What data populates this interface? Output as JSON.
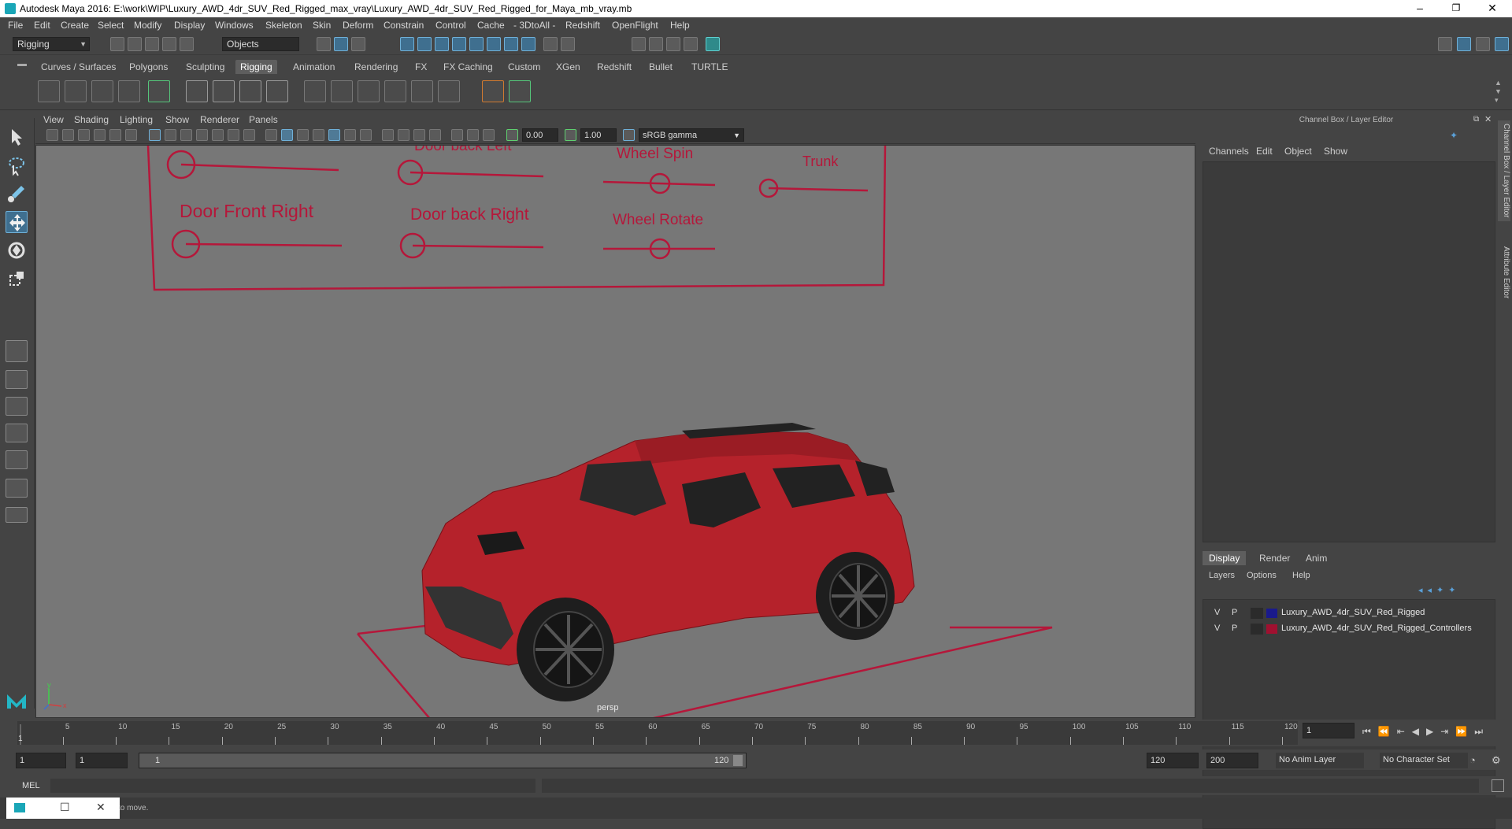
{
  "window": {
    "title": "Autodesk Maya 2016: E:\\work\\WIP\\Luxury_AWD_4dr_SUV_Red_Rigged_max_vray\\Luxury_AWD_4dr_SUV_Red_Rigged_for_Maya_mb_vray.mb",
    "minimize": "–",
    "maximize": "❐",
    "close": "✕"
  },
  "menu": [
    "File",
    "Edit",
    "Create",
    "Select",
    "Modify",
    "Display",
    "Windows",
    "Skeleton",
    "Skin",
    "Deform",
    "Constrain",
    "Control",
    "Cache",
    "- 3DtoAll -",
    "Redshift",
    "OpenFlight",
    "Help"
  ],
  "status": {
    "mode": "Rigging",
    "selection_mode": "Objects"
  },
  "shelf_tabs": [
    "Curves / Surfaces",
    "Polygons",
    "Sculpting",
    "Rigging",
    "Animation",
    "Rendering",
    "FX",
    "FX Caching",
    "Custom",
    "XGen",
    "Redshift",
    "Bullet",
    "TURTLE"
  ],
  "active_shelf": "Rigging",
  "viewport": {
    "menu": [
      "View",
      "Shading",
      "Lighting",
      "Show",
      "Renderer",
      "Panels"
    ],
    "exposure": "0.00",
    "gamma": "1.00",
    "colorspace": "sRGB gamma",
    "camera": "persp",
    "controller_labels": {
      "door_back_left": "Door back Left",
      "wheel_spin": "Wheel Spin",
      "trunk": "Trunk",
      "door_front_right": "Door Front Right",
      "door_back_right": "Door back Right",
      "wheel_rotate": "Wheel Rotate"
    },
    "axis_y": "y",
    "axis_x": "x"
  },
  "channel_box": {
    "title": "Channel Box / Layer Editor",
    "menu": [
      "Channels",
      "Edit",
      "Object",
      "Show"
    ],
    "display_tabs": [
      "Display",
      "Render",
      "Anim"
    ],
    "active_tab": "Display",
    "layer_menu": [
      "Layers",
      "Options",
      "Help"
    ],
    "layers": [
      {
        "v": "V",
        "p": "P",
        "name": "Luxury_AWD_4dr_SUV_Red_Rigged",
        "color": "#1a1a8c"
      },
      {
        "v": "V",
        "p": "P",
        "name": "Luxury_AWD_4dr_SUV_Red_Rigged_Controllers",
        "color": "#a01030"
      }
    ]
  },
  "side_tabs": [
    "Channel Box / Layer Editor",
    "Attribute Editor"
  ],
  "timeline": {
    "ticks": [
      "5",
      "10",
      "15",
      "20",
      "25",
      "30",
      "35",
      "40",
      "45",
      "50",
      "55",
      "60",
      "65",
      "70",
      "75",
      "80",
      "85",
      "90",
      "95",
      "100",
      "105",
      "110",
      "115",
      "120"
    ],
    "start_marker": "1",
    "current_frame": "1"
  },
  "range": {
    "start": "1",
    "playback_start": "1",
    "slider_start": "1",
    "slider_end": "120",
    "playback_end": "120",
    "end": "200",
    "anim_layer": "No Anim Layer",
    "character_set": "No Character Set"
  },
  "command": {
    "label": "MEL"
  },
  "help_line": "to move."
}
